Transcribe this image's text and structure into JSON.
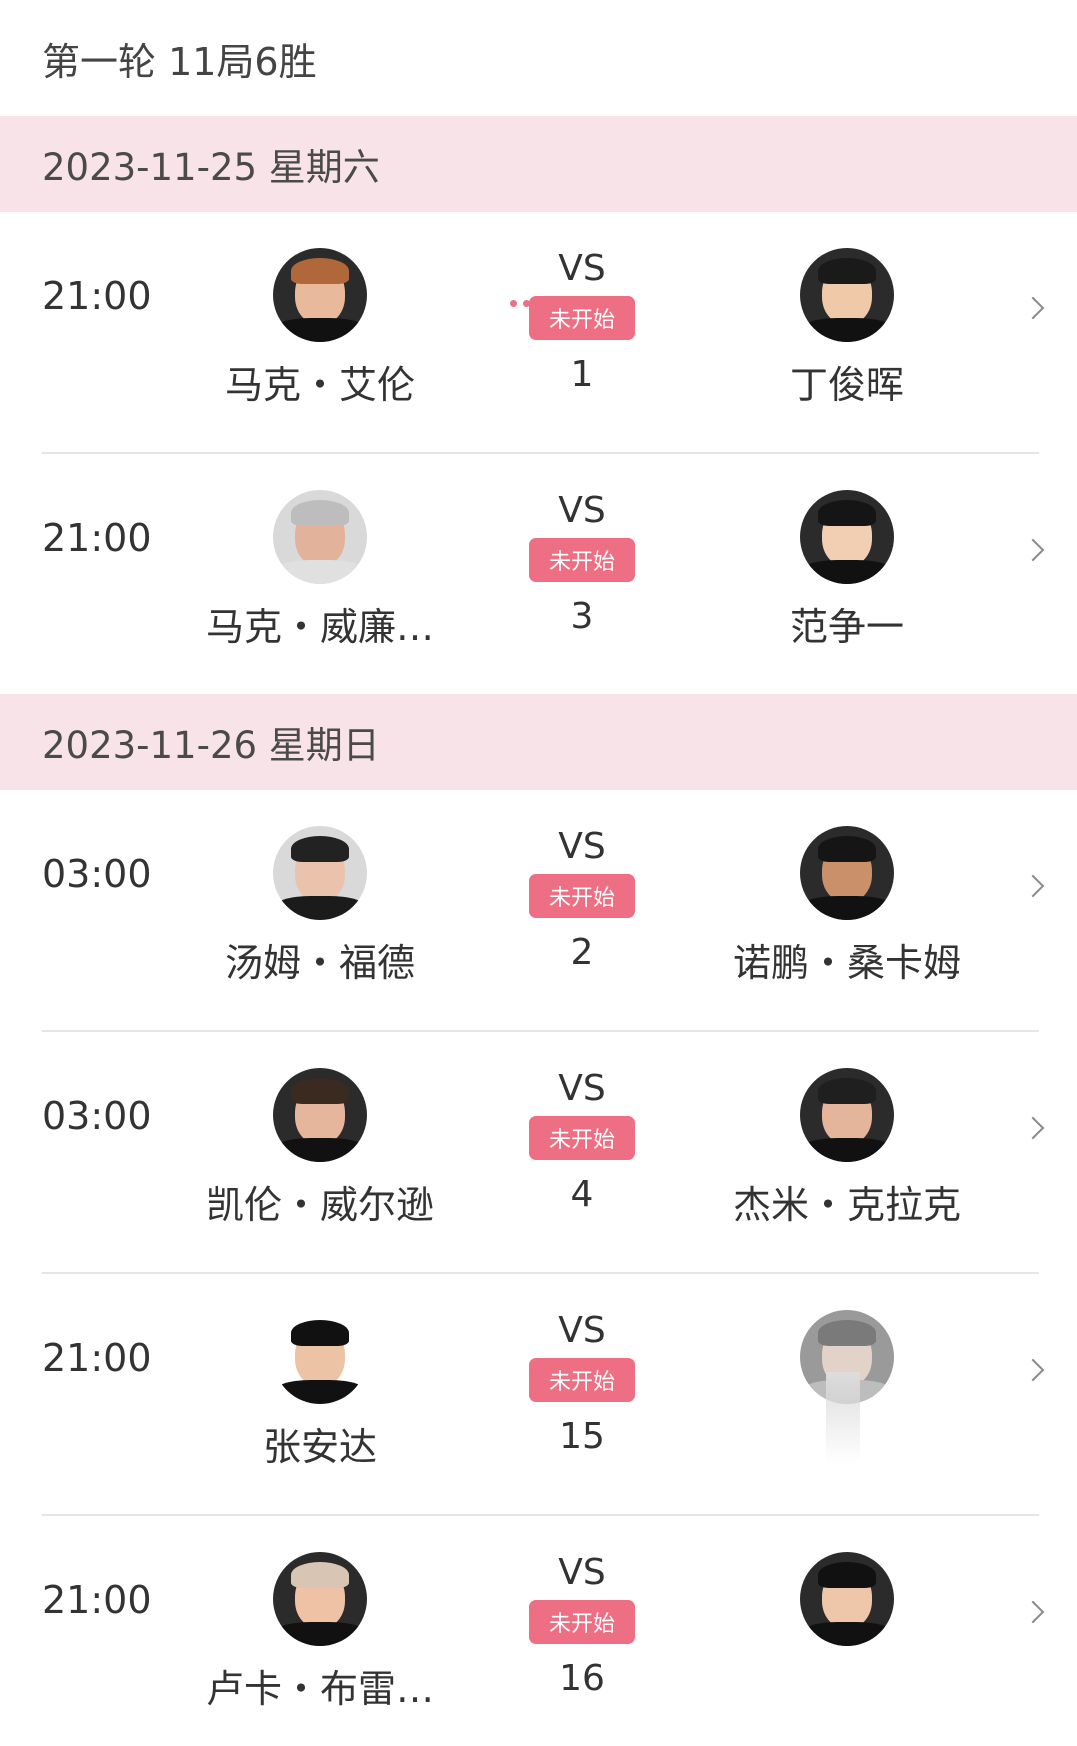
{
  "round_title": "第一轮 11局6胜",
  "days": [
    {
      "date": "2023-11-25 星期六",
      "matches": [
        {
          "time": "21:00",
          "left": "马克・艾伦",
          "right": "丁俊晖",
          "vs": "VS",
          "status": "未开始",
          "number": "1"
        },
        {
          "time": "21:00",
          "left": "马克・威廉…",
          "right": "范争一",
          "vs": "VS",
          "status": "未开始",
          "number": "3"
        }
      ]
    },
    {
      "date": "2023-11-26 星期日",
      "matches": [
        {
          "time": "03:00",
          "left": "汤姆・福德",
          "right": "诺鹏・桑卡姆",
          "vs": "VS",
          "status": "未开始",
          "number": "2"
        },
        {
          "time": "03:00",
          "left": "凯伦・威尔逊",
          "right": "杰米・克拉克",
          "vs": "VS",
          "status": "未开始",
          "number": "4"
        },
        {
          "time": "21:00",
          "left": "张安达",
          "right": "",
          "vs": "VS",
          "status": "未开始",
          "number": "15"
        },
        {
          "time": "21:00",
          "left": "卢卡・布雷…",
          "right": "",
          "vs": "VS",
          "status": "未开始",
          "number": "16"
        }
      ]
    }
  ],
  "colors": {
    "accent": "#ee6f84",
    "date_bar": "#f8e4e8"
  },
  "icons": {
    "row_chevron": "chevron-right-icon",
    "avatar": "player-avatar"
  }
}
